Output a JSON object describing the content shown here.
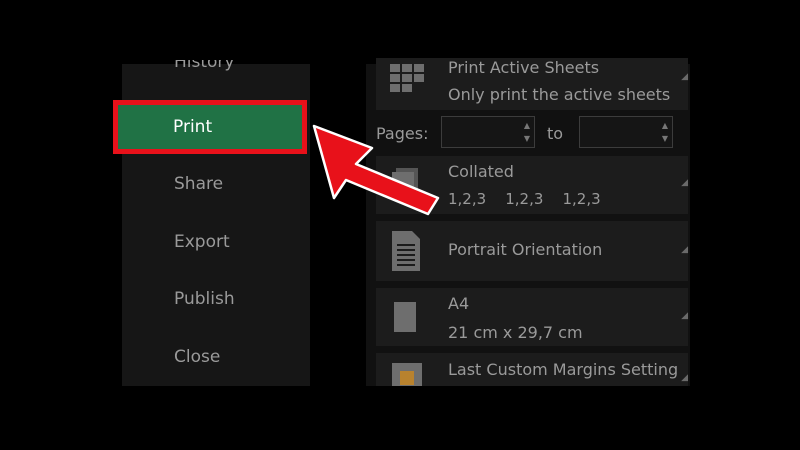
{
  "sidebar": {
    "items": [
      {
        "label": "History"
      },
      {
        "label": "Print"
      },
      {
        "label": "Share"
      },
      {
        "label": "Export"
      },
      {
        "label": "Publish"
      },
      {
        "label": "Close"
      }
    ]
  },
  "print_settings": {
    "sheets": {
      "title": "Print Active Sheets",
      "subtitle": "Only print the active sheets"
    },
    "pages": {
      "label": "Pages:",
      "to_label": "to",
      "from_value": "",
      "to_value": ""
    },
    "collation": {
      "title": "Collated",
      "subtitle": "1,2,3    1,2,3    1,2,3"
    },
    "orientation": {
      "title": "Portrait Orientation"
    },
    "paper": {
      "title": "A4",
      "subtitle": "21 cm x 29,7 cm"
    },
    "margins": {
      "title": "Last Custom Margins Setting"
    }
  },
  "colors": {
    "print_highlight": "#207245",
    "callout_red": "#e8111a"
  },
  "icons": {
    "sheets": "grid-sheet-icon",
    "collated": "collated-pages-icon",
    "orientation": "portrait-page-icon",
    "paper": "paper-size-icon",
    "margins": "margins-icon",
    "arrow": "red-pointer-arrow"
  }
}
